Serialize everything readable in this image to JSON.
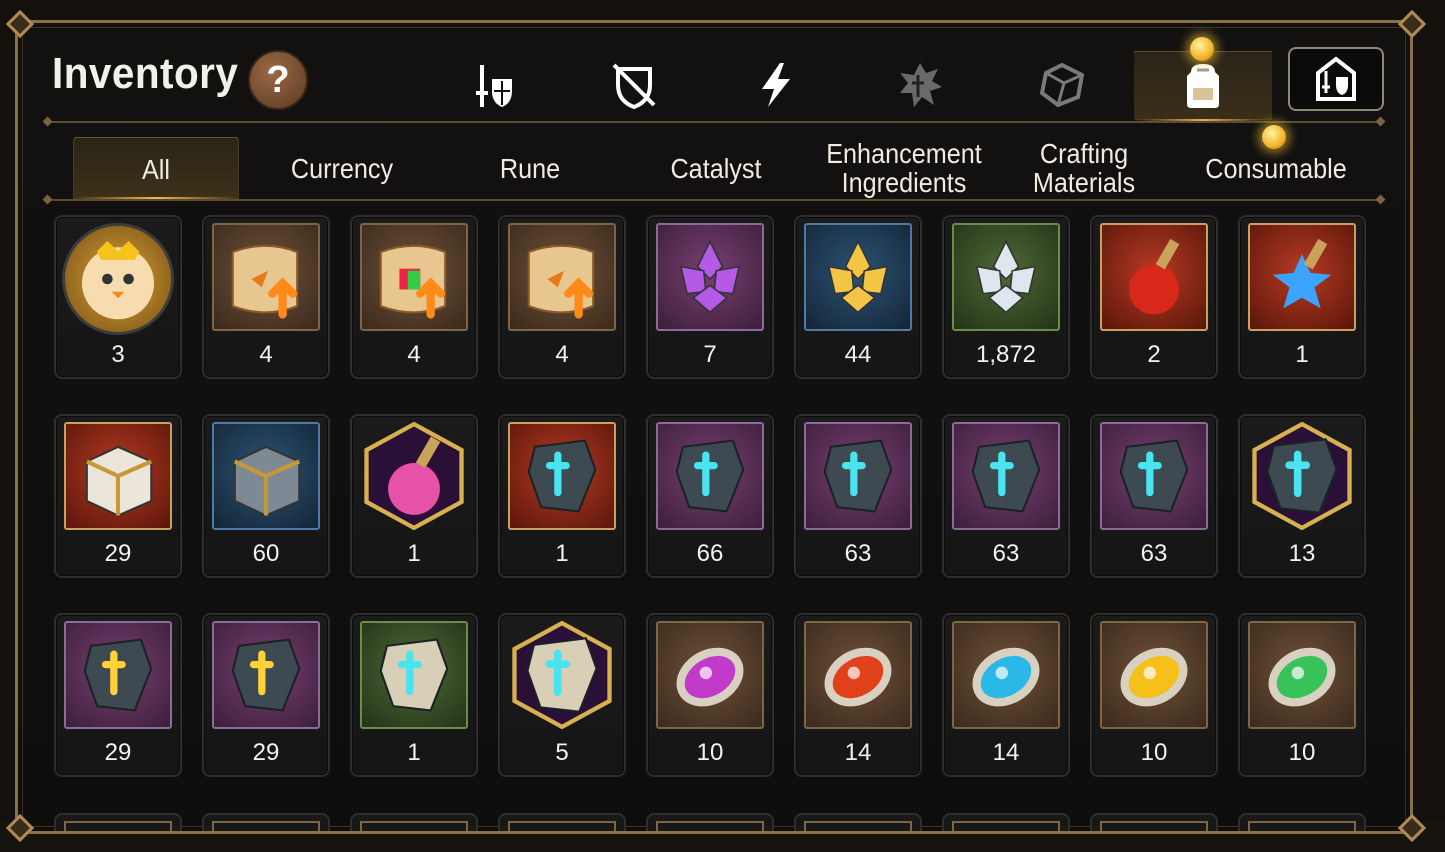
{
  "header": {
    "title": "Inventory",
    "help_label": "?"
  },
  "category_tabs": [
    {
      "icon": "sword-shield-icon",
      "active": false
    },
    {
      "icon": "crossed-shield-icon",
      "active": false
    },
    {
      "icon": "lightning-icon",
      "active": false
    },
    {
      "icon": "rune-icon",
      "active": false
    },
    {
      "icon": "cube-icon",
      "active": false
    },
    {
      "icon": "backpack-icon",
      "active": true,
      "notification": true
    }
  ],
  "loadout_icon": "castle-equipment-icon",
  "sub_tabs": [
    {
      "label": "All",
      "active": true
    },
    {
      "label": "Currency",
      "active": false
    },
    {
      "label": "Rune",
      "active": false
    },
    {
      "label": "Catalyst",
      "active": false
    },
    {
      "label": "Enhancement Ingredients",
      "active": false
    },
    {
      "label": "Crafting Materials",
      "active": false
    },
    {
      "label": "Consumable",
      "active": false,
      "notification": true
    }
  ],
  "items": [
    {
      "icon": "chick-token-icon",
      "count": "3",
      "frame": "round"
    },
    {
      "icon": "upgrade-scroll-icon",
      "count": "4",
      "frame": "brown"
    },
    {
      "icon": "rainbow-scroll-icon",
      "count": "4",
      "frame": "brown"
    },
    {
      "icon": "upgrade-scroll-icon",
      "count": "4",
      "frame": "brown"
    },
    {
      "icon": "purple-crystal-icon",
      "count": "7",
      "frame": "purple"
    },
    {
      "icon": "gold-crystal-icon",
      "count": "44",
      "frame": "blue"
    },
    {
      "icon": "silver-crystal-icon",
      "count": "1,872",
      "frame": "green"
    },
    {
      "icon": "red-potion-icon",
      "count": "2",
      "frame": "red"
    },
    {
      "icon": "star-potion-icon",
      "count": "1",
      "frame": "red"
    },
    {
      "icon": "gold-chest-icon",
      "count": "29",
      "frame": "red"
    },
    {
      "icon": "silver-chest-icon",
      "count": "60",
      "frame": "blue"
    },
    {
      "icon": "pink-potion-icon",
      "count": "1",
      "frame": "hex"
    },
    {
      "icon": "hammer-rune-stone-icon",
      "count": "1",
      "frame": "red"
    },
    {
      "icon": "sword-rune-stone-icon",
      "count": "66",
      "frame": "purple"
    },
    {
      "icon": "spiral-rune-stone-icon",
      "count": "63",
      "frame": "purple"
    },
    {
      "icon": "helm-rune-stone-icon",
      "count": "63",
      "frame": "purple"
    },
    {
      "icon": "boot-rune-stone-icon",
      "count": "63",
      "frame": "purple"
    },
    {
      "icon": "cross-rune-stone-icon",
      "count": "13",
      "frame": "hex"
    },
    {
      "icon": "gold-hammer-stone-icon",
      "count": "29",
      "frame": "purple"
    },
    {
      "icon": "gold-sword-stone-icon",
      "count": "29",
      "frame": "purple"
    },
    {
      "icon": "white-sword-stone-icon",
      "count": "1",
      "frame": "green"
    },
    {
      "icon": "white-cross-stone-icon",
      "count": "5",
      "frame": "hex"
    },
    {
      "icon": "purple-orb-icon",
      "count": "10",
      "frame": "brown"
    },
    {
      "icon": "red-orb-icon",
      "count": "14",
      "frame": "brown"
    },
    {
      "icon": "blue-orb-icon",
      "count": "14",
      "frame": "brown"
    },
    {
      "icon": "yellow-orb-icon",
      "count": "10",
      "frame": "brown"
    },
    {
      "icon": "green-orb-icon",
      "count": "10",
      "frame": "brown"
    }
  ],
  "colors": {
    "panel_border": "#8a7048",
    "accent_gold": "#e9b04c",
    "purple": "#7a3f73",
    "blue": "#2c5477",
    "green": "#4f6a35",
    "red": "#b83a24"
  }
}
